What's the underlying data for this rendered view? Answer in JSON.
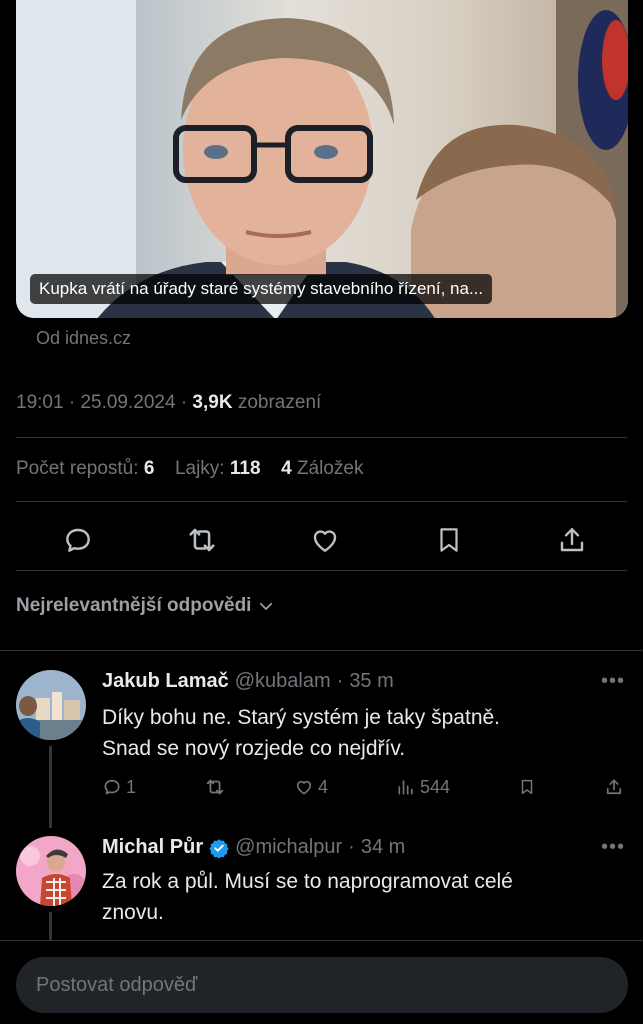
{
  "link_card": {
    "title": "Kupka vrátí na úřady staré systémy stavebního řízení, na...",
    "source": "Od idnes.cz"
  },
  "meta": {
    "time": "19:01",
    "date": "25.09.2024",
    "views_count": "3,9K",
    "views_label": "zobrazení"
  },
  "stats": {
    "reposts_label": "Počet repostů:",
    "reposts_count": "6",
    "likes_label": "Lajky:",
    "likes_count": "118",
    "bookmarks_count": "4",
    "bookmarks_label": "Záložek"
  },
  "action_icons": [
    "reply-icon",
    "repost-icon",
    "like-icon",
    "bookmark-icon",
    "share-icon"
  ],
  "sort": {
    "label": "Nejrelevantnější odpovědi"
  },
  "replies": [
    {
      "name": "Jakub Lamač",
      "handle": "@kubalam",
      "time": "35 m",
      "verified": false,
      "line1": "Díky bohu ne. Starý systém je taky špatně.",
      "line2": "Snad se nový rozjede co nejdřív.",
      "replies": "1",
      "reposts": "",
      "likes": "4",
      "views": "544"
    },
    {
      "name": "Michal Půr",
      "handle": "@michalpur",
      "time": "34 m",
      "verified": true,
      "line1": "Za rok a půl. Musí se to naprogramovat celé",
      "line2": "znovu."
    }
  ],
  "reply_box": {
    "placeholder": "Postovat odpověď"
  },
  "colors": {
    "background": "#000000",
    "muted": "#71767b",
    "divider": "#2f3336",
    "verified": "#1d9bf0"
  }
}
